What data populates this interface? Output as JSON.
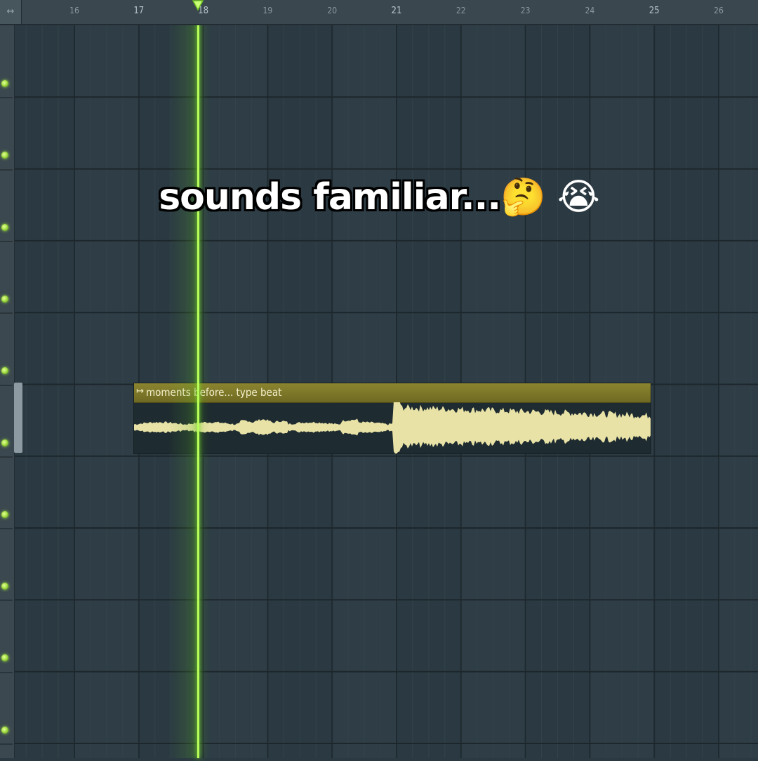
{
  "ruler": {
    "corner_icon": "↔",
    "bars": [
      {
        "label": "16",
        "dim": true
      },
      {
        "label": "17",
        "dim": false
      },
      {
        "label": "18",
        "dim": false
      },
      {
        "label": "19",
        "dim": true
      },
      {
        "label": "20",
        "dim": true
      },
      {
        "label": "21",
        "dim": false
      },
      {
        "label": "22",
        "dim": true
      },
      {
        "label": "23",
        "dim": true
      },
      {
        "label": "24",
        "dim": true
      },
      {
        "label": "25",
        "dim": false
      },
      {
        "label": "26",
        "dim": true
      }
    ]
  },
  "clip": {
    "icon": "↦",
    "name": "moments before... type beat"
  },
  "caption": {
    "text": "sounds familiar...",
    "emojis": [
      "🤔",
      "😭"
    ]
  },
  "colors": {
    "playhead": "#b8ff5a",
    "clip_header": "#8b8530",
    "waveform": "#e8e2a6",
    "grid_background": "#2b3a42"
  },
  "icons": {
    "playhead_marker": "playhead-marker-icon",
    "track_led": "track-led-icon",
    "clip": "clip-arrow-icon"
  }
}
